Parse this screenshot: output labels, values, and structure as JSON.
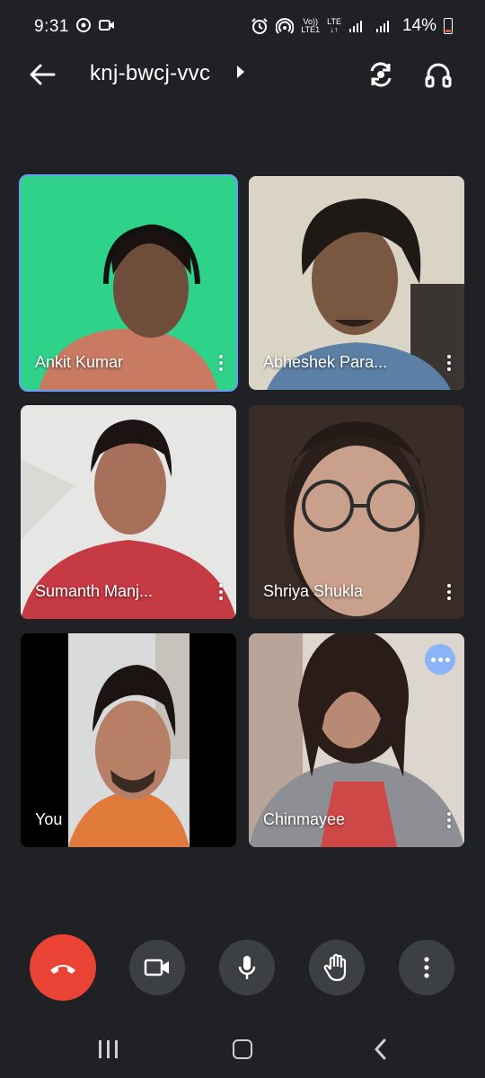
{
  "status_bar": {
    "time": "9:31",
    "network_label_top": "Vo))",
    "network_label_bottom": "LTE1",
    "lte_top": "LTE",
    "lte_bottom": "↓↑",
    "battery": "14%"
  },
  "header": {
    "meeting_code": "knj-bwcj-vvc"
  },
  "participants": [
    {
      "name": "Ankit Kumar",
      "active": true
    },
    {
      "name": "Abheshek Para..."
    },
    {
      "name": "Sumanth Manj..."
    },
    {
      "name": "Shriya Shukla"
    },
    {
      "name": "You"
    },
    {
      "name": "Chinmayee",
      "speaking_indicator": true
    }
  ],
  "controls": {
    "icons": [
      "end-call-icon",
      "camera-icon",
      "microphone-icon",
      "raise-hand-icon",
      "more-vert-icon"
    ]
  },
  "navbar": {
    "icons": [
      "recent-apps-icon",
      "home-icon",
      "back-icon"
    ]
  },
  "colors": {
    "background": "#202124",
    "end_call": "#ea4335",
    "control_button": "#3c4043",
    "active_outline": "#669df6",
    "speaking_indicator": "#8ab4f8"
  }
}
